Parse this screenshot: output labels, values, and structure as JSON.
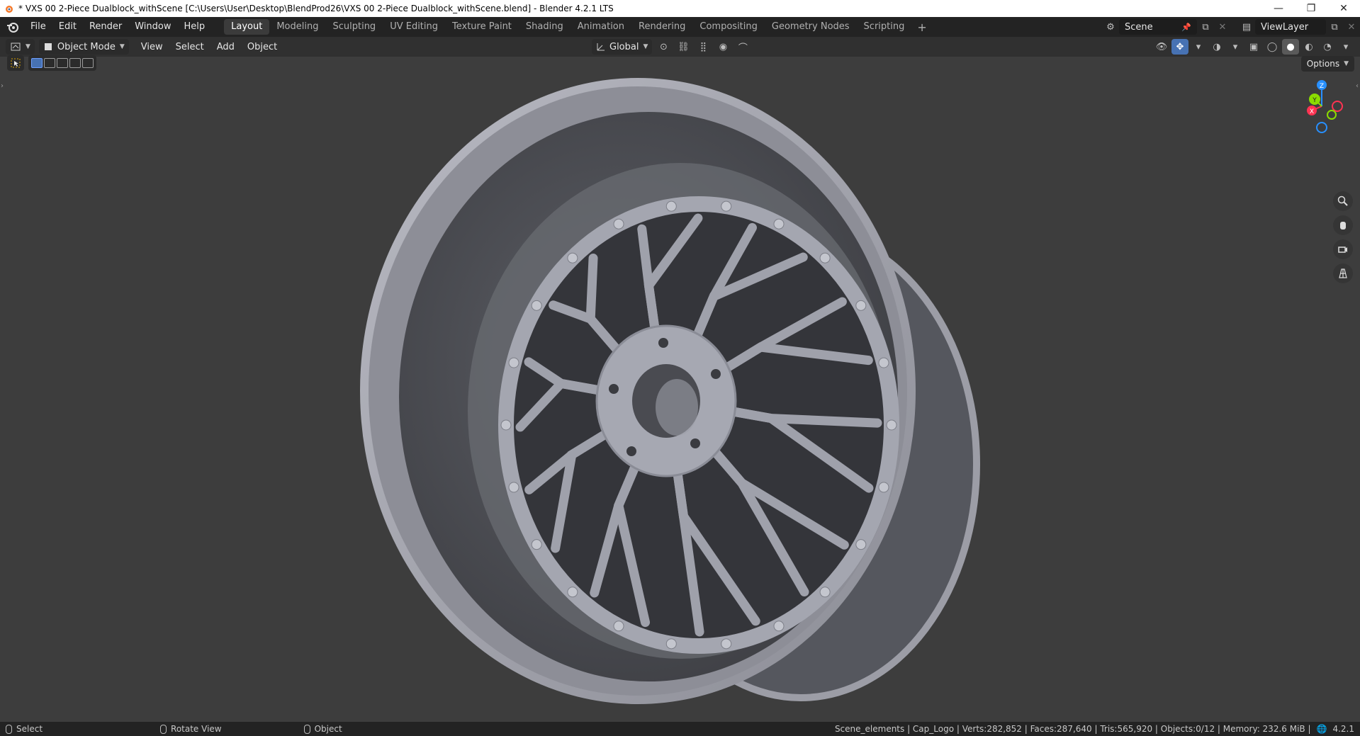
{
  "window": {
    "title": "* VXS 00 2-Piece Dualblock_withScene [C:\\Users\\User\\Desktop\\BlendProd26\\VXS 00 2-Piece Dualblock_withScene.blend] - Blender 4.2.1 LTS",
    "minimize": "—",
    "restore": "❐",
    "close": "✕"
  },
  "menu": [
    "File",
    "Edit",
    "Render",
    "Window",
    "Help"
  ],
  "workspaces": {
    "active": "Layout",
    "tabs": [
      "Layout",
      "Modeling",
      "Sculpting",
      "UV Editing",
      "Texture Paint",
      "Shading",
      "Animation",
      "Rendering",
      "Compositing",
      "Geometry Nodes",
      "Scripting"
    ],
    "add": "+"
  },
  "scene": {
    "name": "Scene",
    "view_layer": "ViewLayer"
  },
  "header": {
    "mode": "Object Mode",
    "menus": [
      "View",
      "Select",
      "Add",
      "Object"
    ],
    "transform_orientation": "Global",
    "options": "Options"
  },
  "gizmo": {
    "z": "Z",
    "y": "Y",
    "x": "X"
  },
  "status": {
    "select": "Select",
    "rotate": "Rotate View",
    "object": "Object",
    "stats": "Scene_elements | Cap_Logo | Verts:282,852 | Faces:287,640 | Tris:565,920 | Objects:0/12 | Memory: 232.6 MiB |",
    "version": "4.2.1"
  },
  "colors": {
    "accent": "#4772b3",
    "viewport_bg": "#3d3d3d",
    "axis_x": "#ff3352",
    "axis_y": "#8bdc00",
    "axis_z": "#2890ff"
  }
}
